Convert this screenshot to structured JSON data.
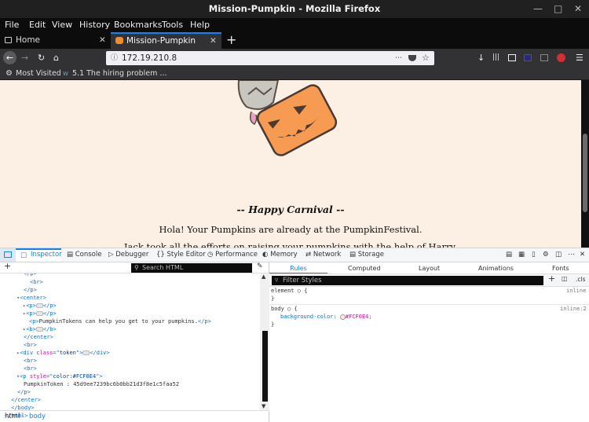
{
  "window": {
    "title": "Mission-Pumpkin - Mozilla Firefox"
  },
  "menu": {
    "items": [
      "File",
      "Edit",
      "View",
      "History",
      "Bookmarks",
      "Tools",
      "Help"
    ]
  },
  "tabs": [
    {
      "label": "Home",
      "active": false
    },
    {
      "label": "Mission-Pumpkin",
      "active": true
    }
  ],
  "urlbar": {
    "value": "172.19.210.8"
  },
  "bookmarks": [
    {
      "label": "Most Visited"
    },
    {
      "label": "5.1 The hiring problem ..."
    }
  ],
  "page": {
    "background": "#FCF0E4",
    "heading": "-- Happy Carnival --",
    "line1": "Hola! Your Pumpkins are already at the PumpkinFestival.",
    "line2": "Jack took all the efforts on raising your pumpkins with the help of Harry."
  },
  "devtools": {
    "tabs": [
      "Inspector",
      "Console",
      "Debugger",
      "Style Editor",
      "Performance",
      "Memory",
      "Network",
      "Storage"
    ],
    "search_placeholder": "Search HTML",
    "tree": {
      "p_close": "</p>",
      "br": "<br>",
      "center_open": "<center>",
      "p_empty": "<p>",
      "p_close_short": "</p>",
      "pumpkintokens_text": "PumpkinTokens can help you get to your pumpkins.",
      "b_open": "<b>",
      "b_close": "</b>",
      "center_close": "</center>",
      "div_class": "token",
      "p_style": "color:#FCF0E4",
      "pumpkin_token": "PumpkinToken : 45d9ee7239bc6b0bb21d3f8e1c5faa52",
      "body_close": "</body>",
      "html_close": "</html>"
    },
    "breadcrumb": [
      "html",
      "body"
    ],
    "side_tabs": [
      "Rules",
      "Computed",
      "Layout",
      "Animations",
      "Fonts"
    ],
    "filter_placeholder": "Filter Styles",
    "cls_label": ".cls",
    "rules": [
      {
        "selector": "element",
        "source": "inline",
        "prop": "",
        "value": ""
      },
      {
        "selector": "body",
        "source": "inline:2",
        "prop": "background-color:",
        "value": "#FCF0E4;"
      }
    ]
  }
}
